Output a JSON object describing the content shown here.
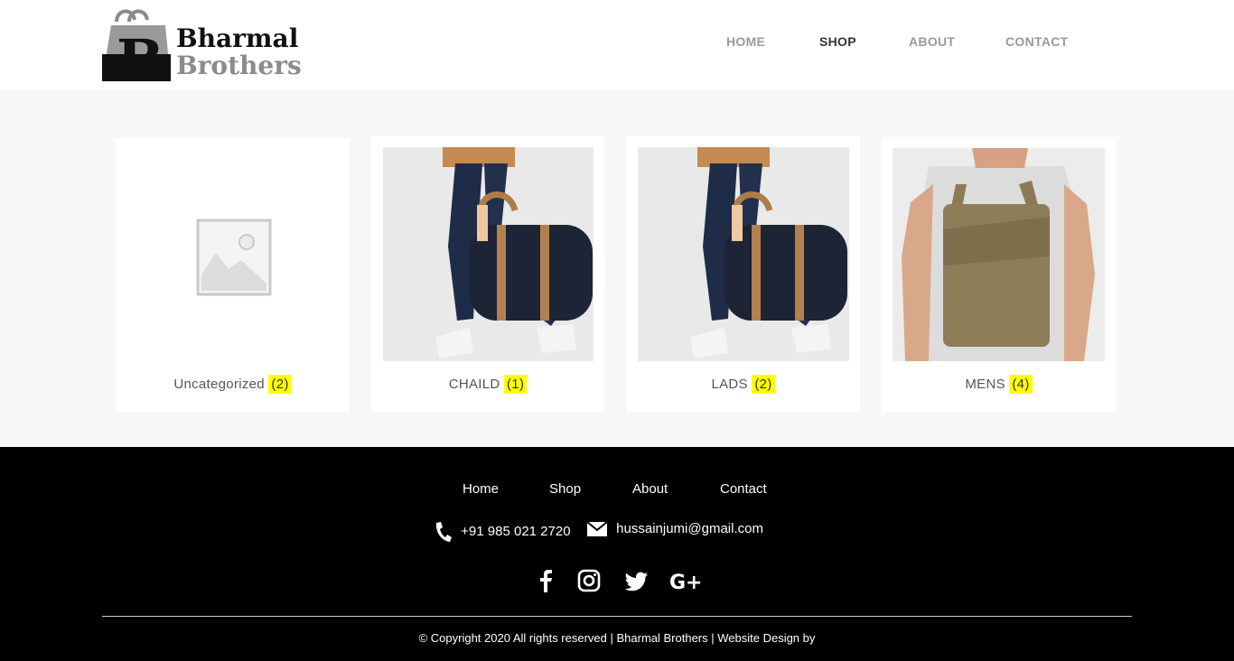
{
  "brand": {
    "name_line1": "Bharmal",
    "name_line2": "Brothers"
  },
  "nav": {
    "items": [
      {
        "label": "HOME",
        "active": false
      },
      {
        "label": "SHOP",
        "active": true
      },
      {
        "label": "ABOUT",
        "active": false
      },
      {
        "label": "CONTACT",
        "active": false
      }
    ]
  },
  "categories": [
    {
      "name": "Uncategorized",
      "count": "(2)",
      "image": "placeholder-image-icon"
    },
    {
      "name": "CHAILD",
      "count": "(1)",
      "image": "duffel-bag-photo"
    },
    {
      "name": "LADS",
      "count": "(2)",
      "image": "duffel-bag-photo"
    },
    {
      "name": "MENS",
      "count": "(4)",
      "image": "backpack-photo"
    }
  ],
  "footer": {
    "nav": [
      "Home",
      "Shop",
      "About",
      "Contact"
    ],
    "phone": "+91 985 021 2720",
    "email": "hussainjumi@gmail.com",
    "social": [
      "facebook-icon",
      "instagram-icon",
      "twitter-icon",
      "google-plus-icon"
    ],
    "copyright": "© Copyright 2020 All rights reserved | Bharmal Brothers | Website Design by"
  },
  "colors": {
    "count_highlight": "#ffff00",
    "footer_bg": "#000000",
    "page_bg": "#f7f7f7",
    "nav_active": "#333333",
    "nav_inactive": "#9a9a9a"
  }
}
